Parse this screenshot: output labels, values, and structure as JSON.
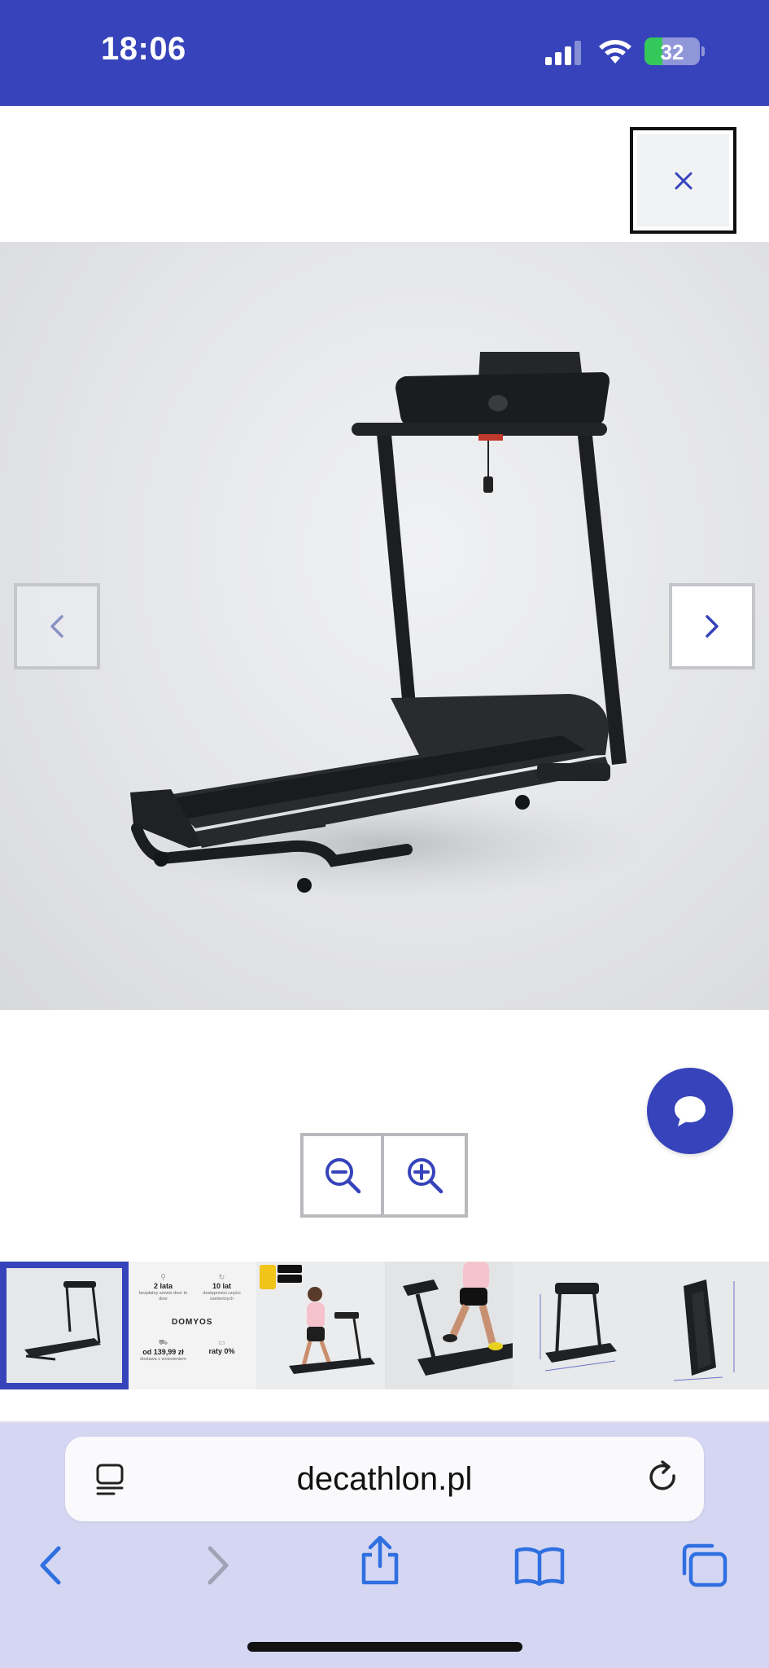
{
  "status_bar": {
    "time": "18:06",
    "battery_level": "32",
    "battery_charging": true,
    "signal_bars": 3,
    "wifi": true,
    "background_color": "#3643ba"
  },
  "viewer": {
    "close_label": "×",
    "prev_icon": "chevron-left-icon",
    "next_icon": "chevron-right-icon",
    "chat_icon": "chat-bubble-icon",
    "zoom_out_icon": "zoom-out-icon",
    "zoom_in_icon": "zoom-in-icon",
    "accent_color": "#3643ba",
    "active_thumbnail": 1
  },
  "thumbnails": [
    {
      "kind": "treadmill-studio",
      "active": true
    },
    {
      "kind": "service-info",
      "active": false,
      "cells": [
        {
          "big": "2 lata",
          "small": "bezpłatny serwis door to door"
        },
        {
          "big": "10 lat",
          "small": "dostępności części zamiennych"
        },
        {
          "big": "od 139,99 zł",
          "small": "dostawa z wniesieniem"
        },
        {
          "big": "raty 0%",
          "small": ""
        }
      ],
      "brand": "DOMYOS"
    },
    {
      "kind": "woman-walking-app",
      "active": false
    },
    {
      "kind": "runner-closeup",
      "active": false
    },
    {
      "kind": "dimensions-front",
      "active": false
    },
    {
      "kind": "dimensions-folded",
      "active": false
    }
  ],
  "browser": {
    "url": "decathlon.pl",
    "reader_icon": "reader-mode-icon",
    "reload_icon": "reload-icon",
    "toolbar": [
      "back-icon",
      "forward-icon",
      "share-icon",
      "bookmarks-icon",
      "tabs-icon"
    ],
    "background_color": "#d4d6f2"
  }
}
